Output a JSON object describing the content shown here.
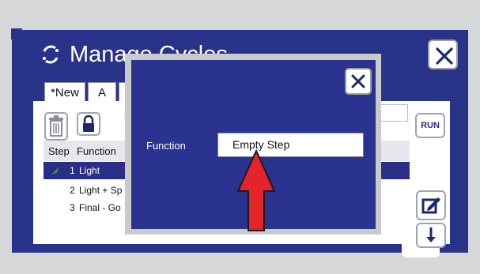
{
  "window": {
    "title": "Manage Cycles",
    "close_icon": "close-x-icon",
    "refresh_icon": "refresh-icon"
  },
  "tabs": [
    {
      "label": "*New"
    },
    {
      "label": "A"
    }
  ],
  "toolbar": {
    "trash_icon": "trash-icon",
    "lock_icon": "lock-icon",
    "run_label": "RUN",
    "edit_icon": "edit-icon",
    "down_icon": "arrow-down-icon"
  },
  "table": {
    "headers": [
      "Step",
      "Function"
    ],
    "rows": [
      {
        "step": "1",
        "function": "Light",
        "selected": true
      },
      {
        "step": "2",
        "function": "Light + Sp",
        "selected": false
      },
      {
        "step": "3",
        "function": "Final - Go",
        "selected": false
      }
    ]
  },
  "dialog": {
    "function_label": "Function",
    "function_value": "Empty Step",
    "close_icon": "close-x-icon"
  },
  "colors": {
    "window_blue": "#2a338a",
    "dialog_blue": "#2a3490",
    "selected_row": "#2a2e86",
    "arrow_red": "#e3242b",
    "step_marker_green": "#2f9e2f"
  }
}
